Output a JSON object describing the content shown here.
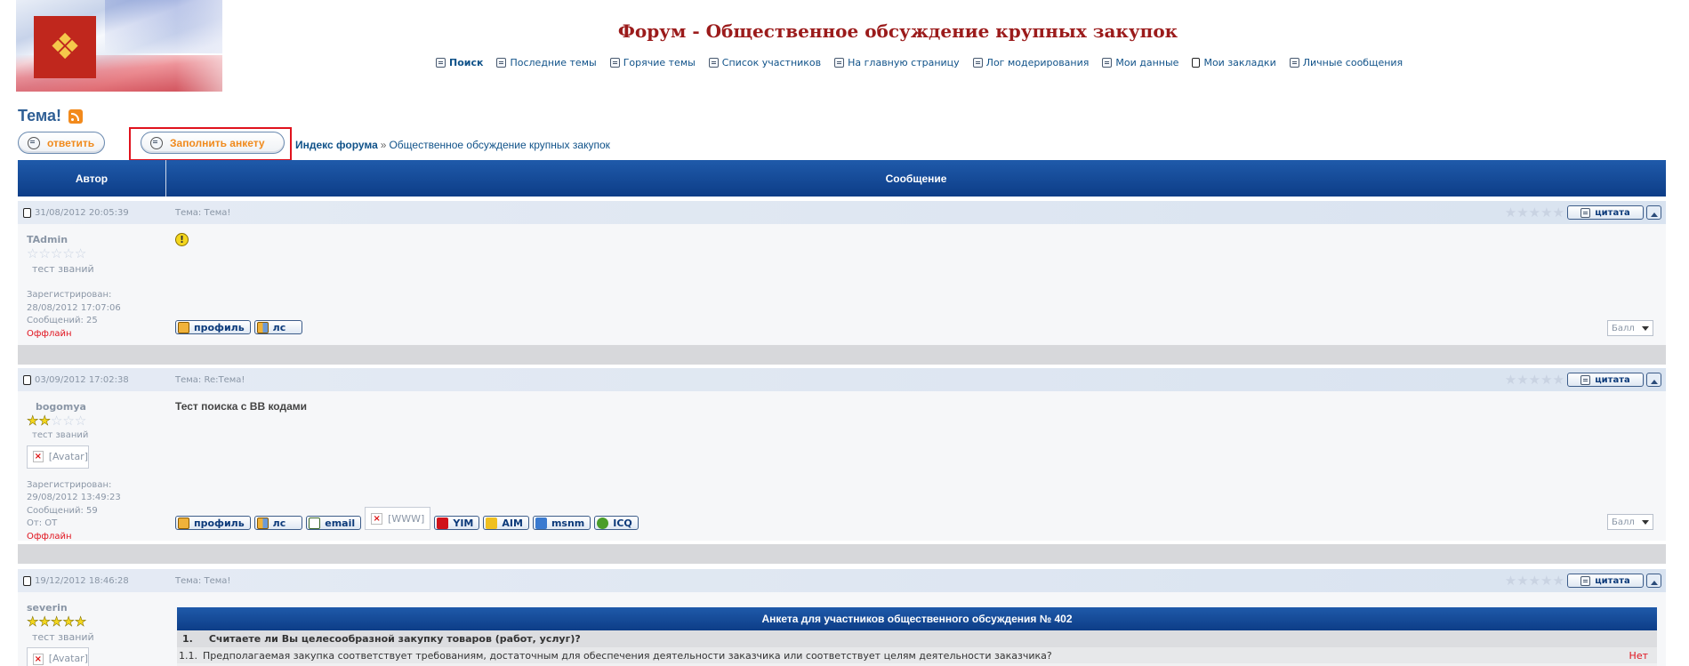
{
  "header": {
    "site_title": "Форум - Общественное обсуждение крупных закупок",
    "nav": [
      {
        "label": "Поиск",
        "icon": "search-icon"
      },
      {
        "label": "Последние темы",
        "icon": "topics-icon"
      },
      {
        "label": "Горячие темы",
        "icon": "hot-topics-icon"
      },
      {
        "label": "Список участников",
        "icon": "members-icon"
      },
      {
        "label": "На главную страницу",
        "icon": "home-icon"
      },
      {
        "label": "Лог модерирования",
        "icon": "log-icon"
      },
      {
        "label": "Мои данные",
        "icon": "profile-icon"
      },
      {
        "label": "Мои закладки",
        "icon": "bookmark-icon"
      },
      {
        "label": "Личные сообщения",
        "icon": "messages-icon"
      }
    ]
  },
  "topic": {
    "title": "Тема!",
    "reply_label": "ответить",
    "fill_label": "Заполнить анкету",
    "breadcrumb": {
      "index": "Индекс форума",
      "separator": "»",
      "section": "Общественное обсуждение крупных закупок"
    }
  },
  "table": {
    "author_header": "Автор",
    "message_header": "Сообщение"
  },
  "ui": {
    "quote_label": "цитата",
    "ball_label": "Балл",
    "accent": "#0d3d87",
    "offline_color": "#e0121d"
  },
  "posts": [
    {
      "date": "31/08/2012 20:05:39",
      "subject": "Тема: Тема!",
      "author": "TAdmin",
      "author_stars": 0,
      "rank": "тест званий",
      "registered": "Зарегистрирован: 28/08/2012 17:07:06",
      "messages": "Сообщений: 25",
      "status": "Оффлайн",
      "buttons": [
        "профиль",
        "лс"
      ]
    },
    {
      "date": "03/09/2012 17:02:38",
      "subject": "Тема: Re:Тема!",
      "author": "bogomya",
      "author_stars": 2,
      "rank": "тест званий",
      "avatar_alt": "[Avatar]",
      "registered": "Зарегистрирован: 29/08/2012 13:49:23",
      "messages": "Сообщений: 59",
      "from": "От: ОТ",
      "status": "Оффлайн",
      "text": "Тест поиска с BB кодами",
      "buttons": [
        "профиль",
        "лс",
        "email",
        "[WWW]",
        "YIM",
        "AIM",
        "msnm",
        "ICQ"
      ]
    },
    {
      "date": "19/12/2012 18:46:28",
      "subject": "Тема: Тема!",
      "author": "severin",
      "author_stars": 5,
      "rank": "тест званий",
      "avatar_alt": "[Avatar]"
    }
  ],
  "poll": {
    "title": "Анкета для участников общественного обсуждения № 402",
    "question_num": "1.",
    "question": "Считаете ли Вы целесообразной закупку товаров (работ, услуг)?",
    "answer_num": "1.1.",
    "answer": "Предполагаемая закупка соответствует требованиям, достаточным для обеспечения деятельности заказчика или соответствует целям деятельности заказчика?",
    "answer_value": "Нет"
  }
}
